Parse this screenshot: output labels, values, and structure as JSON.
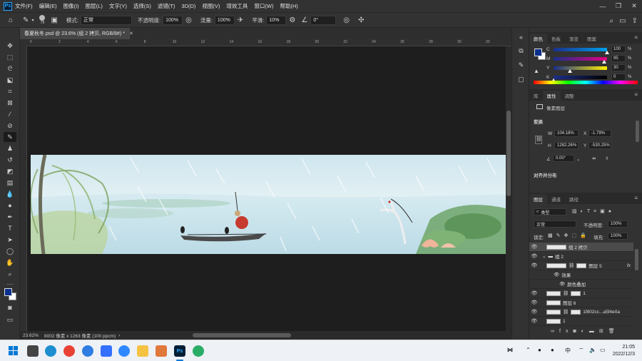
{
  "app": {
    "logo": "Ps"
  },
  "menu": [
    "文件(F)",
    "编辑(E)",
    "图像(I)",
    "图层(L)",
    "文字(Y)",
    "选择(S)",
    "滤镜(T)",
    "3D(D)",
    "视图(V)",
    "增效工具",
    "窗口(W)",
    "帮助(H)"
  ],
  "options": {
    "brush_size": "78",
    "mode_label": "模式:",
    "mode_value": "正常",
    "opacity_label": "不透明度:",
    "opacity_value": "100%",
    "flow_label": "流量:",
    "flow_value": "100%",
    "smooth_label": "平滑:",
    "smooth_value": "10%",
    "angle_value": "0°"
  },
  "document": {
    "tab_title": "春夏秋冬.psd @ 23.6% (组 2 拷贝, RGB/8#) *",
    "ruler_ticks": [
      "0",
      "2",
      "4",
      "6",
      "8",
      "10",
      "12",
      "14",
      "16",
      "18",
      "20",
      "22",
      "24",
      "26",
      "28",
      "30",
      "32"
    ],
    "zoom": "23.62%",
    "doc_info": "8002 像素 x 1263 像素 (100 ppcm)"
  },
  "color_panel": {
    "tabs": [
      "颜色",
      "色板",
      "渐变",
      "图案"
    ],
    "channels": [
      {
        "label": "C",
        "value": "100",
        "fraction": 1.0,
        "color": "#00a0e9"
      },
      {
        "label": "M",
        "value": "95",
        "fraction": 0.95,
        "color": "#e4007f"
      },
      {
        "label": "Y",
        "value": "30",
        "fraction": 0.3,
        "color": "#fff100"
      },
      {
        "label": "K",
        "value": "0",
        "fraction": 0.0,
        "color": "#000000"
      }
    ],
    "pct": "%",
    "fg_color": "#0b2f8c"
  },
  "properties_panel": {
    "tabs": [
      "库",
      "属性",
      "调整"
    ],
    "layer_type": "像素图层",
    "transform_heading": "变换",
    "w_label": "W",
    "w_value": "104.18%",
    "x_label": "X",
    "x_value": "-1.79%",
    "h_label": "H",
    "h_value": "1282.26%",
    "y_label": "Y",
    "y_value": "-530.25%",
    "angle_value": "0.00°",
    "align_heading": "对齐并分布"
  },
  "layers_panel": {
    "tabs": [
      "图层",
      "通道",
      "路径"
    ],
    "filter_label": "类型",
    "blend_mode": "正常",
    "opacity_label": "不透明度:",
    "opacity_value": "100%",
    "lock_label": "锁定:",
    "fill_label": "填充:",
    "fill_value": "100%",
    "layers": [
      {
        "name": "组 2 拷贝",
        "selected": true
      },
      {
        "name": "组 2",
        "selected": false
      },
      {
        "name": "图层 5",
        "selected": false,
        "fx": "fx"
      },
      {
        "name": "效果",
        "selected": false
      },
      {
        "name": "颜色叠加",
        "selected": false
      },
      {
        "name": "1",
        "selected": false
      },
      {
        "name": "图层 6",
        "selected": false
      },
      {
        "name": "1f802cc...a5f4e0a",
        "selected": false
      },
      {
        "name": "1",
        "selected": false
      }
    ]
  },
  "taskbar": {
    "apps": [
      "Windows",
      "Task View",
      "Edge",
      "Chrome",
      "Tencent",
      "Feishu",
      "Browser",
      "Files",
      "App",
      "Ps",
      "WeChat"
    ],
    "ime": "中",
    "time": "21:05",
    "date": "2022/12/3"
  }
}
